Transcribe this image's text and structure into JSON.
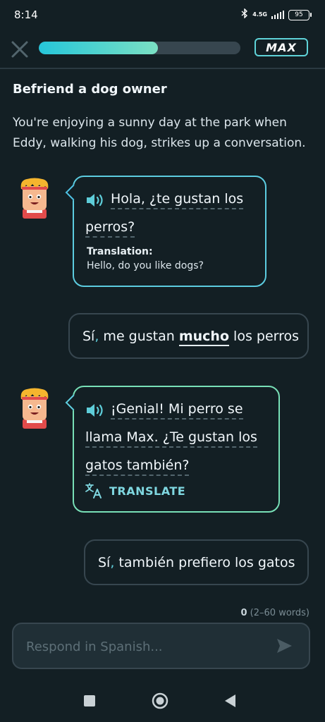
{
  "status_bar": {
    "time": "8:14",
    "network": "4.5G",
    "battery": "95"
  },
  "header": {
    "progress_percent": 59,
    "badge_label": "MAX"
  },
  "scenario": {
    "title": "Befriend a dog owner",
    "description": "You're enjoying a sunny day at the park when Eddy, walking his dog, strikes up a conversation."
  },
  "messages": {
    "ai_1": {
      "line_1": "Hola, ¿te gustan los",
      "line_2": "perros?",
      "translation_label": "Translation:",
      "translation_text": "Hello, do you like dogs?"
    },
    "user_1": {
      "part_1": "Sí",
      "comma": ",",
      "part_2": " me gustan ",
      "highlight": "mucho",
      "part_3": " los perros"
    },
    "ai_2": {
      "line_1": "¡Genial! Mi perro se",
      "line_2": "llama Max. ¿Te gustan los",
      "line_3": "gatos también?",
      "translate_label": "TRANSLATE"
    },
    "user_2": {
      "part_1": "Sí",
      "comma": ",",
      "part_2": " también prefiero los gatos"
    }
  },
  "composer": {
    "word_count_value": "0",
    "word_count_range": " (2–60 words)",
    "placeholder": "Respond in Spanish..."
  },
  "icons": {
    "close": "close-icon",
    "speaker": "speaker-icon",
    "translate": "translate-icon",
    "send": "send-icon",
    "avatar": "eddy-avatar"
  },
  "colors": {
    "background": "#131f24",
    "accent": "#5ecdd9",
    "progress_start": "#26c6da",
    "progress_end": "#7be0c3"
  }
}
